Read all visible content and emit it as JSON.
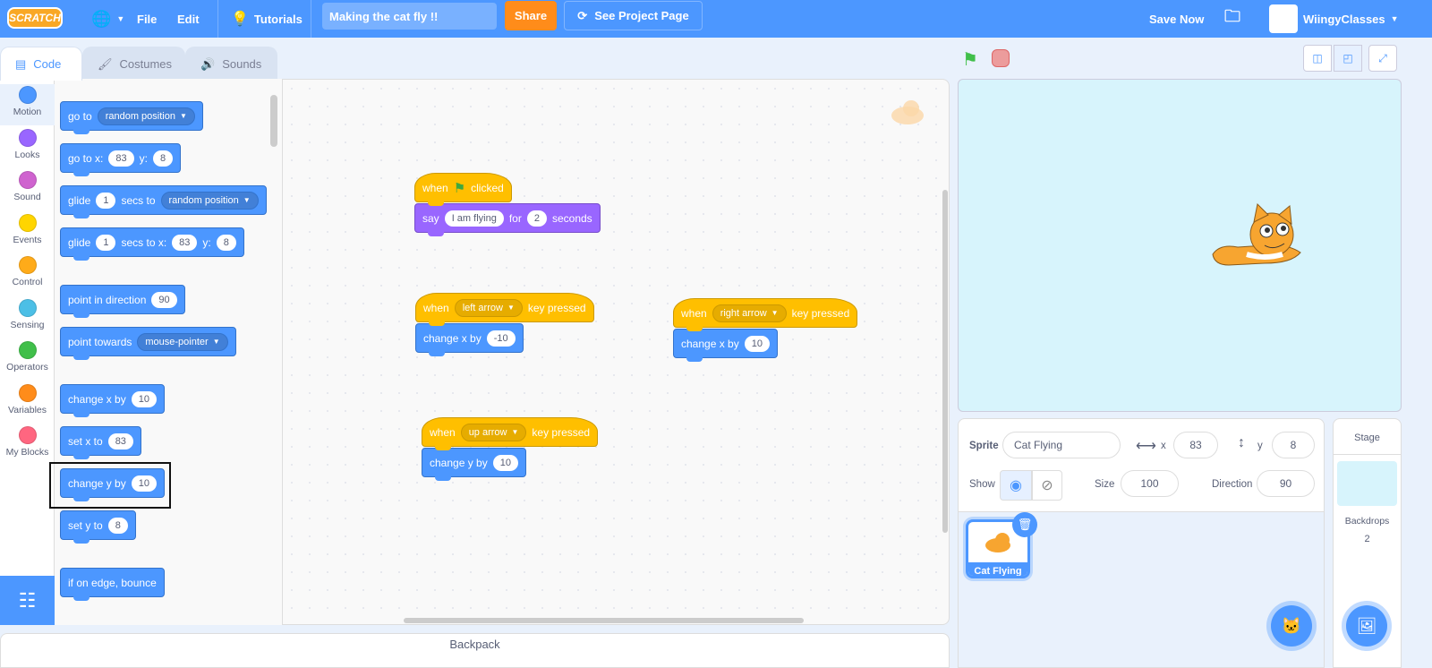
{
  "menubar": {
    "logo": "SCRATCH",
    "file": "File",
    "edit": "Edit",
    "tutorials": "Tutorials",
    "project_title": "Making the cat fly !!",
    "share": "Share",
    "see_project_page": "See Project Page",
    "save_now": "Save Now",
    "username": "WiingyClasses"
  },
  "tabs": [
    {
      "label": "Code"
    },
    {
      "label": "Costumes"
    },
    {
      "label": "Sounds"
    }
  ],
  "categories": [
    {
      "label": "Motion",
      "color": "#4c97ff"
    },
    {
      "label": "Looks",
      "color": "#9966ff"
    },
    {
      "label": "Sound",
      "color": "#cf63cf"
    },
    {
      "label": "Events",
      "color": "#ffd500"
    },
    {
      "label": "Control",
      "color": "#ffab19"
    },
    {
      "label": "Sensing",
      "color": "#4cbfe6"
    },
    {
      "label": "Operators",
      "color": "#40bf4a"
    },
    {
      "label": "Variables",
      "color": "#ff8c1a"
    },
    {
      "label": "My Blocks",
      "color": "#ff6680"
    }
  ],
  "palette_blocks": [
    {
      "kind": "motion",
      "parts": [
        {
          "t": "go to"
        },
        {
          "d": "random position"
        }
      ]
    },
    {
      "kind": "motion",
      "parts": [
        {
          "t": "go to x:"
        },
        {
          "i": "83"
        },
        {
          "t": "y:"
        },
        {
          "i": "8"
        }
      ]
    },
    {
      "kind": "motion",
      "parts": [
        {
          "t": "glide"
        },
        {
          "i": "1"
        },
        {
          "t": "secs to"
        },
        {
          "d": "random position"
        }
      ]
    },
    {
      "kind": "motion",
      "parts": [
        {
          "t": "glide"
        },
        {
          "i": "1"
        },
        {
          "t": "secs to x:"
        },
        {
          "i": "83"
        },
        {
          "t": "y:"
        },
        {
          "i": "8"
        }
      ]
    },
    {
      "kind": "motion",
      "parts": [
        {
          "t": "point in direction"
        },
        {
          "i": "90"
        }
      ]
    },
    {
      "kind": "motion",
      "parts": [
        {
          "t": "point towards"
        },
        {
          "d": "mouse-pointer"
        }
      ]
    },
    {
      "kind": "motion",
      "parts": [
        {
          "t": "change x by"
        },
        {
          "i": "10"
        }
      ]
    },
    {
      "kind": "motion",
      "parts": [
        {
          "t": "set x to"
        },
        {
          "i": "83"
        }
      ]
    },
    {
      "kind": "motion",
      "parts": [
        {
          "t": "change y by"
        },
        {
          "i": "10"
        }
      ],
      "highlighted": true
    },
    {
      "kind": "motion",
      "parts": [
        {
          "t": "set y to"
        },
        {
          "i": "8"
        }
      ]
    },
    {
      "kind": "motion",
      "parts": [
        {
          "t": "if on edge, bounce"
        }
      ]
    }
  ],
  "scripts": [
    {
      "blocks": [
        {
          "kind": "events",
          "hat": true,
          "parts": [
            {
              "t": "when"
            },
            {
              "flag": "green-flag"
            },
            {
              "t": "clicked"
            }
          ]
        },
        {
          "kind": "looks",
          "parts": [
            {
              "t": "say"
            },
            {
              "i": "I am flying"
            },
            {
              "t": "for"
            },
            {
              "i": "2"
            },
            {
              "t": "seconds"
            }
          ]
        }
      ]
    },
    {
      "blocks": [
        {
          "kind": "events",
          "hat": true,
          "parts": [
            {
              "t": "when"
            },
            {
              "d": "left arrow"
            },
            {
              "t": "key pressed"
            }
          ]
        },
        {
          "kind": "motion",
          "parts": [
            {
              "t": "change x by"
            },
            {
              "i": "-10"
            }
          ]
        }
      ]
    },
    {
      "blocks": [
        {
          "kind": "events",
          "hat": true,
          "parts": [
            {
              "t": "when"
            },
            {
              "d": "right arrow"
            },
            {
              "t": "key pressed"
            }
          ]
        },
        {
          "kind": "motion",
          "parts": [
            {
              "t": "change x by"
            },
            {
              "i": "10"
            }
          ]
        }
      ]
    },
    {
      "blocks": [
        {
          "kind": "events",
          "hat": true,
          "parts": [
            {
              "t": "when"
            },
            {
              "d": "up arrow"
            },
            {
              "t": "key pressed"
            }
          ]
        },
        {
          "kind": "motion",
          "parts": [
            {
              "t": "change y by"
            },
            {
              "i": "10"
            }
          ]
        }
      ]
    }
  ],
  "backpack": "Backpack",
  "sprite_info": {
    "sprite_label": "Sprite",
    "sprite_name": "Cat Flying",
    "x_label": "x",
    "x": "83",
    "y_label": "y",
    "y": "8",
    "show_label": "Show",
    "size_label": "Size",
    "size": "100",
    "direction_label": "Direction",
    "direction": "90"
  },
  "sprites": [
    {
      "name": "Cat Flying",
      "selected": true
    }
  ],
  "stage_pane": {
    "title": "Stage",
    "backdrops_label": "Backdrops",
    "backdrops_count": "2"
  },
  "colors": {
    "accent": "#4c97ff",
    "share": "#ff8c1a",
    "events": "#ffbf00",
    "looks": "#9966ff",
    "stage_bg": "#d7f4fc"
  }
}
